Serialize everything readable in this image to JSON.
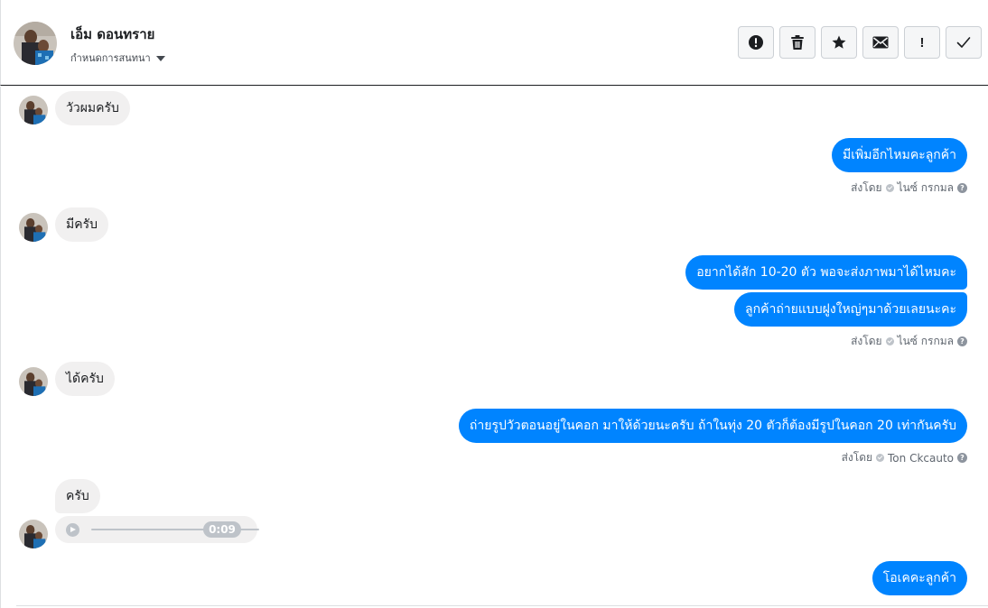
{
  "header": {
    "contact_name": "เอ็ม ดอนทราย",
    "assign_label": "กำหนดการสนทนา",
    "actions": [
      {
        "icon": "alert-circle-icon",
        "label": "spam"
      },
      {
        "icon": "trash-icon",
        "label": "delete"
      },
      {
        "icon": "star-icon",
        "label": "star"
      },
      {
        "icon": "envelope-icon",
        "label": "mark-unread"
      },
      {
        "icon": "exclamation-icon",
        "label": "follow-up"
      },
      {
        "icon": "check-icon",
        "label": "mark-done"
      }
    ]
  },
  "messages": {
    "m1": "วัวผมครับ",
    "m2": "มีเพิ่มอีกไหมคะลูกค้า",
    "m3": "มีครับ",
    "m4": "อยากได้สัก 10-20 ตัว พอจะส่งภาพมาได้ไหมคะ",
    "m5": "ลูกค้าถ่ายแบบฝูงใหญ่ๆมาด้วยเลยนะคะ",
    "m6": "ได้ครับ",
    "m7": "ถ่ายรูปวัวตอนอยู่ในคอก มาให้ด้วยนะครับ ถ้าในทุ่ง 20 ตัวก็ต้องมีรูปในคอก 20 เท่ากันครับ",
    "m8": "ครับ",
    "m9": "โอเคคะลูกค้า"
  },
  "sent_by": {
    "prefix": "ส่งโดย",
    "agent_1": "ไนซ์ กรกมล",
    "agent_2": "ไนซ์ กรกมล",
    "agent_3": "Ton Ckcauto"
  },
  "audio": {
    "duration": "0:09"
  },
  "colors": {
    "outgoing_bubble": "#0084ff",
    "incoming_bubble": "#f1f0f0"
  }
}
